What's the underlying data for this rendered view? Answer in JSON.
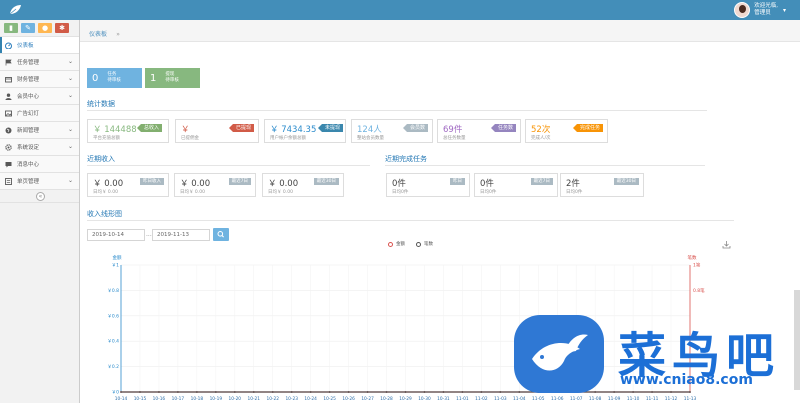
{
  "user": {
    "greeting": "欢迎光临,",
    "name": "管理员"
  },
  "breadcrumb": {
    "current": "仪表板",
    "separator": "»"
  },
  "sidebar": {
    "items": [
      {
        "label": "仪表板",
        "icon": "dashboard-icon",
        "active": true
      },
      {
        "label": "任务管理",
        "icon": "flag-icon",
        "has_children": true
      },
      {
        "label": "财务管理",
        "icon": "wallet-icon",
        "has_children": true
      },
      {
        "label": "会员中心",
        "icon": "user-icon",
        "has_children": true
      },
      {
        "label": "广告幻灯",
        "icon": "image-icon",
        "has_children": false
      },
      {
        "label": "新闻管理",
        "icon": "globe-icon",
        "has_children": true
      },
      {
        "label": "系统设定",
        "icon": "gear-icon",
        "has_children": true
      },
      {
        "label": "消息中心",
        "icon": "chat-icon",
        "has_children": false
      },
      {
        "label": "单页管理",
        "icon": "list-icon",
        "has_children": true
      }
    ]
  },
  "tasks": [
    {
      "num": "0",
      "line1": "任务",
      "line2": "待审核",
      "color": "#6fb3e0"
    },
    {
      "num": "1",
      "line1": "提现",
      "line2": "待审核",
      "color": "#87b87f"
    }
  ],
  "stats_title": "统计数据",
  "stats": [
    {
      "value": "￥ 144488",
      "sub": "平台充值总额",
      "badge": "总收入",
      "color": "#87b87f",
      "badge_color": "#82af6f"
    },
    {
      "value": "￥",
      "sub": "已提佣金",
      "badge": "已提现",
      "color": "#d15b47",
      "badge_color": "#d15b47"
    },
    {
      "value": "￥ 7434.35",
      "sub": "用户帐户余额总额",
      "badge": "未提现",
      "color": "#2a8bcc",
      "badge_color": "#3a87ad"
    },
    {
      "value": "124人",
      "sub": "整站会员数量",
      "badge": "会员数",
      "color": "#6fb3e0",
      "badge_color": "#abbac3"
    },
    {
      "value": "69件",
      "sub": "总任务数量",
      "badge": "任务数",
      "color": "#a069c3",
      "badge_color": "#9585bf"
    },
    {
      "value": "52次",
      "sub": "完成人/次",
      "badge": "完成任务",
      "color": "#f89406",
      "badge_color": "#f89406"
    }
  ],
  "income_title": "近期收入",
  "income": [
    {
      "value": "￥ 0.00",
      "sub": "日均￥ 0.00",
      "badge": "昨日收入"
    },
    {
      "value": "￥ 0.00",
      "sub": "日均￥ 0.00",
      "badge": "最近7日"
    },
    {
      "value": "￥ 0.00",
      "sub": "日均￥ 0.00",
      "badge": "最近30日"
    }
  ],
  "tasks_done_title": "近期完成任务",
  "tasks_done": [
    {
      "value": "0件",
      "sub": "日均0件",
      "badge": "昨日"
    },
    {
      "value": "0件",
      "sub": "日均0件",
      "badge": "最近7日"
    },
    {
      "value": "2件",
      "sub": "日均0件",
      "badge": "最近30日"
    }
  ],
  "chart_section_title": "收入线形图",
  "filter": {
    "start": "2019-10-14",
    "end": "2019-11-13",
    "separator": "..."
  },
  "chart_data": {
    "type": "line",
    "legend": [
      "金额",
      "笔数"
    ],
    "left_axis_label": "金额",
    "right_axis_label": "笔数",
    "left_ticks": [
      "￥1",
      "￥0.8",
      "￥0.6",
      "￥0.4",
      "￥0.2",
      "￥0"
    ],
    "right_ticks": [
      "1笔",
      "0.8笔"
    ],
    "categories": [
      "10-14",
      "10-15",
      "10-16",
      "10-17",
      "10-18",
      "10-19",
      "10-20",
      "10-21",
      "10-22",
      "10-23",
      "10-24",
      "10-25",
      "10-26",
      "10-27",
      "10-28",
      "10-29",
      "10-30",
      "10-31",
      "11-01",
      "11-02",
      "11-03",
      "11-04",
      "11-05",
      "11-06",
      "11-07",
      "11-08",
      "11-09",
      "11-10",
      "11-11",
      "11-12",
      "11-13"
    ],
    "series": [
      {
        "name": "金额",
        "color": "#d9534f",
        "values": [
          0,
          0,
          0,
          0,
          0,
          0,
          0,
          0,
          0,
          0,
          0,
          0,
          0,
          0,
          0,
          0,
          0,
          0,
          0,
          0,
          0,
          0,
          0,
          0,
          0,
          0,
          0,
          0,
          0,
          0,
          0
        ]
      },
      {
        "name": "笔数",
        "color": "#555555",
        "values": [
          0,
          0,
          0,
          0,
          0,
          0,
          0,
          0,
          0,
          0,
          0,
          0,
          0,
          0,
          0,
          0,
          0,
          0,
          0,
          0,
          0,
          0,
          0,
          0,
          0,
          0,
          0,
          0,
          0,
          0,
          0
        ]
      }
    ],
    "ylim": [
      0,
      1
    ]
  },
  "watermark": {
    "title": "菜鸟吧",
    "url": "www.cniao8.com"
  }
}
